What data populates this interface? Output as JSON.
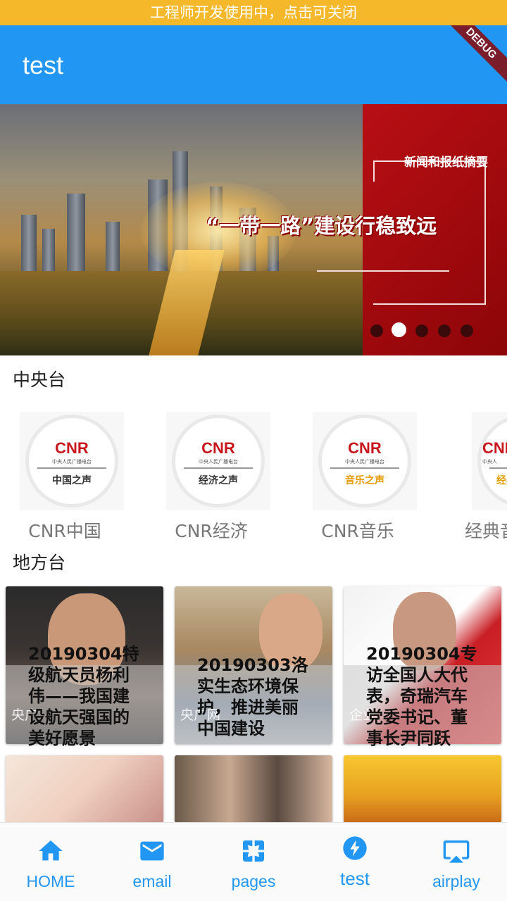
{
  "notice": {
    "text": "工程师开发使用中，点击可关闭"
  },
  "appbar": {
    "title": "test",
    "debug_banner": "DEBUG"
  },
  "banner": {
    "kicker": "新闻和报纸摘要",
    "headline": "“一带一路”建设行稳致远",
    "slide_count": 5,
    "active_slide": 2
  },
  "sections": {
    "central": "中央台",
    "local": "地方台"
  },
  "stations": [
    {
      "label": "CNR中国",
      "logo_brand": "CNR",
      "logo_sub": "中央人民广播电台",
      "logo_name": "中国之声",
      "logo_variant": "plain"
    },
    {
      "label": "CNR经济",
      "logo_brand": "CNR",
      "logo_sub": "中央人民广播电台",
      "logo_name": "经济之声",
      "logo_variant": "plain"
    },
    {
      "label": "CNR音乐",
      "logo_brand": "CNR",
      "logo_sub": "中央人民广播电台",
      "logo_name": "音乐之声",
      "logo_variant": "music"
    },
    {
      "label": "经典音",
      "logo_brand": "CNR",
      "logo_sub": "中央人",
      "logo_name": "经典",
      "logo_variant": "golden"
    }
  ],
  "cards": [
    {
      "title": "20190304特级航天员杨利伟——我国建设航天强国的美好愿景",
      "caption": "央广",
      "photo": "man-portrait-dark"
    },
    {
      "title": "20190303洛实生态环境保护，推进美丽中国建设",
      "caption": "央广网",
      "photo": "woman-glasses-conference"
    },
    {
      "title": "20190304专访全国人大代表，奇瑞汽车党委书记、董事长尹同跃",
      "caption": "企业",
      "photo": "man-glasses-red"
    },
    {
      "title": "",
      "caption": "",
      "photo": "dream-of-red-mansions"
    },
    {
      "title": "",
      "caption": "",
      "photo": "drama-faces"
    },
    {
      "title": "",
      "caption": "",
      "photo": "golden-figure"
    }
  ],
  "nav": {
    "items": [
      {
        "label": "HOME",
        "icon": "home-icon"
      },
      {
        "label": "email",
        "icon": "email-icon"
      },
      {
        "label": "pages",
        "icon": "pages-icon"
      },
      {
        "label": "test",
        "icon": "flash-icon"
      },
      {
        "label": "airplay",
        "icon": "airplay-icon"
      }
    ],
    "active_index": 3
  },
  "colors": {
    "primary": "#2196f3",
    "notice": "#f5b82a",
    "banner_red": "#b80f14",
    "cnr_red": "#c8161d"
  }
}
